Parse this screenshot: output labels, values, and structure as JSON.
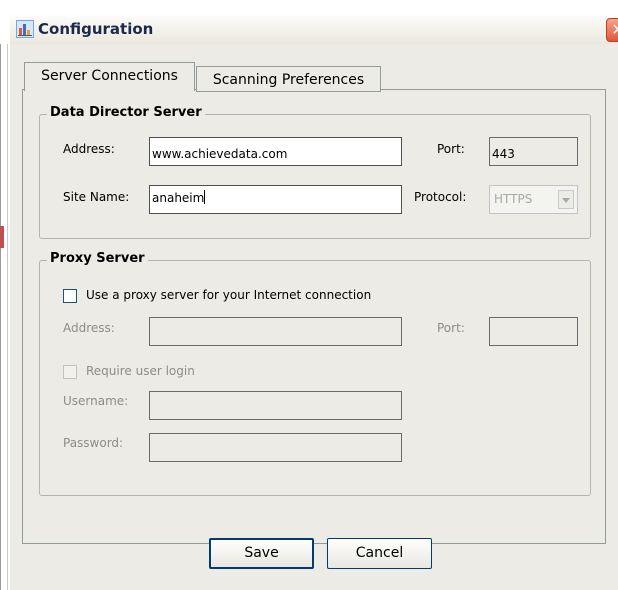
{
  "window": {
    "title": "Configuration",
    "close_glyph": "✕",
    "icon": "app-chart-icon"
  },
  "tabs": [
    {
      "label": "Server Connections",
      "active": true
    },
    {
      "label": "Scanning Preferences",
      "active": false
    }
  ],
  "data_director": {
    "legend": "Data Director Server",
    "address_label": "Address:",
    "address_value": "www.achievedata.com",
    "port_label": "Port:",
    "port_value": "443",
    "site_label": "Site Name:",
    "site_value": "anaheim",
    "protocol_label": "Protocol:",
    "protocol_value": "HTTPS"
  },
  "proxy": {
    "legend": "Proxy Server",
    "use_proxy_label": "Use a proxy server for your Internet connection",
    "use_proxy_checked": false,
    "address_label": "Address:",
    "address_value": "",
    "port_label": "Port:",
    "port_value": "",
    "require_login_label": "Require user login",
    "require_login_checked": false,
    "username_label": "Username:",
    "username_value": "",
    "password_label": "Password:",
    "password_value": ""
  },
  "buttons": {
    "save": "Save",
    "cancel": "Cancel"
  },
  "colors": {
    "dialog_bg": "#ecebe5",
    "close_button": "#e0563a",
    "button_border": "#003c74"
  }
}
